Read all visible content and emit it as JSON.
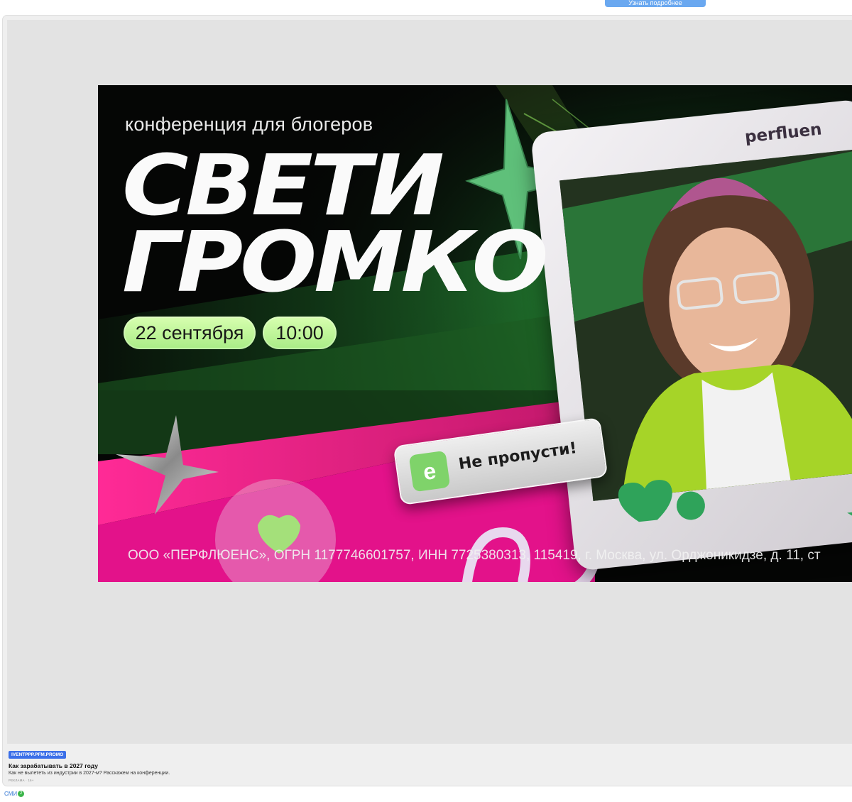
{
  "top_button": {
    "label": "Узнать подробнее"
  },
  "banner": {
    "subtitle": "конференция для блогеров",
    "title_line1": "СВЕТИ",
    "title_line2": "ГРОМКО",
    "date": "22 сентября",
    "time": "10:00",
    "badge_icon_letter": "e",
    "badge_text": "Не пропусти!",
    "frame_brand": "perfluen",
    "legal_text": "ООО «ПЕРФЛЮЕНС», ОГРН 1177746601757, ИНН 7725380313, 115419, г. Москва, ул. Орджоникидзе, д. 11, ст"
  },
  "ad": {
    "source_badge": "IVENTPPP.PFM.PROMO",
    "title": "Как зарабатывать в 2027 году",
    "description": "Как не вылететь из индустрии в 2027-м? Расскажем на конференции.",
    "label": "РЕКЛАМА · 16+"
  },
  "footer": {
    "smi_label": "СМИ",
    "smi_count": "2"
  },
  "colors": {
    "accent_green": "#7fd36a",
    "pill_green": "#c9f8a0",
    "magenta": "#ff2a96",
    "link_blue": "#3a7bd5",
    "badge_blue": "#3b6fe8"
  }
}
